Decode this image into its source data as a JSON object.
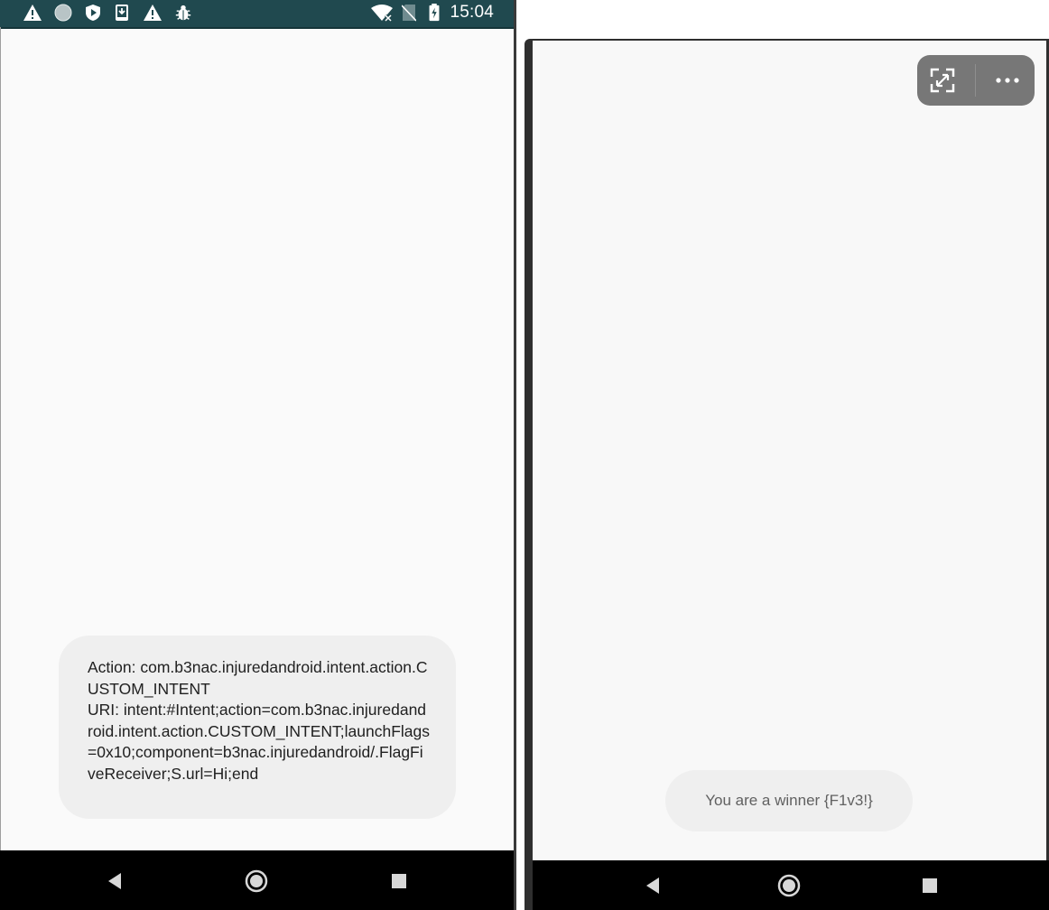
{
  "left_phone": {
    "status_bar": {
      "time": "15:04",
      "left_icons": [
        "warning-icon",
        "circle-icon",
        "shield-icon",
        "download-icon",
        "warning-icon",
        "bug-icon"
      ],
      "right_icons": [
        "wifi-off-icon",
        "no-sim-icon",
        "battery-charging-icon"
      ]
    },
    "toast": {
      "text": "Action: com.b3nac.injuredandroid.intent.action.CUSTOM_INTENT\nURI: intent:#Intent;action=com.b3nac.injuredandroid.intent.action.CUSTOM_INTENT;launchFlags=0x10;component=b3nac.injuredandroid/.FlagFiveReceiver;S.url=Hi;end"
    },
    "nav": {
      "buttons": [
        "back-icon",
        "home-icon",
        "recents-icon"
      ]
    }
  },
  "right_phone": {
    "pip_controls": [
      "expand-icon",
      "more-icon"
    ],
    "toast": {
      "text": "You are a winner {F1v3!}"
    },
    "nav": {
      "buttons": [
        "back-icon",
        "home-icon",
        "recents-icon"
      ]
    }
  },
  "colors": {
    "status_bar": "#20494f",
    "screen_bg": "#fafafa",
    "toast_bg": "#efefef",
    "nav_bg": "#000000",
    "pip_bg": "#777777"
  }
}
